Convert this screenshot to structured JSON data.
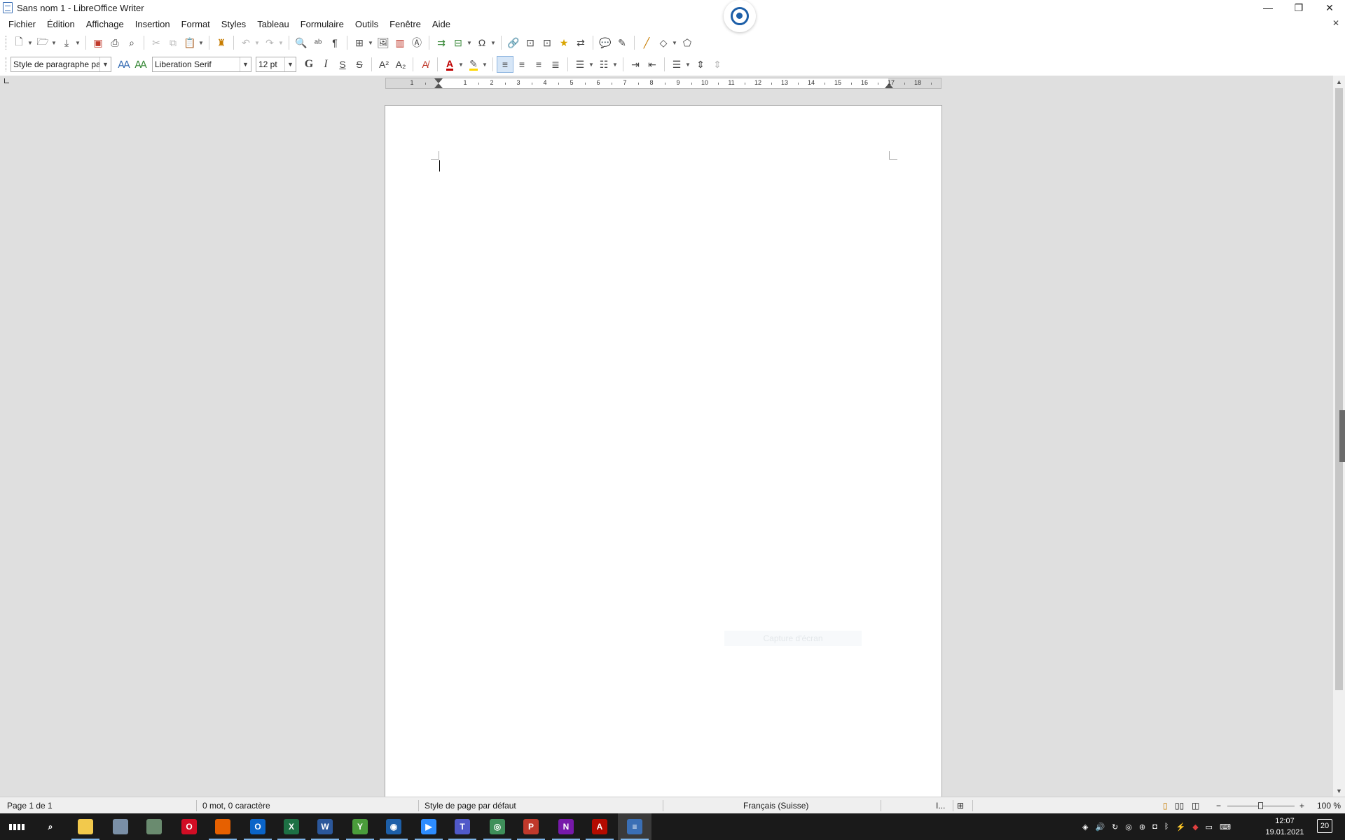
{
  "window": {
    "title": "Sans nom 1 - LibreOffice Writer",
    "controls": {
      "minimize": "—",
      "restore": "❐",
      "close": "✕"
    },
    "doc_close": "✕"
  },
  "menu": [
    "Fichier",
    "Édition",
    "Affichage",
    "Insertion",
    "Format",
    "Styles",
    "Tableau",
    "Formulaire",
    "Outils",
    "Fenêtre",
    "Aide"
  ],
  "formatting": {
    "paragraph_style": "Style de paragraphe par défaut",
    "font_name": "Liberation Serif",
    "font_size": "12 pt",
    "bold": "G",
    "italic": "I",
    "underline": "S",
    "strike": "S",
    "alignment": "left"
  },
  "ruler": {
    "ticks": [
      "1",
      "1",
      "2",
      "3",
      "4",
      "5",
      "6",
      "7",
      "8",
      "9",
      "10",
      "11",
      "12",
      "13",
      "14",
      "15",
      "16",
      "17",
      "18"
    ]
  },
  "page": {
    "ghost_text": "Capture d'écran"
  },
  "statusbar": {
    "page": "Page 1 de 1",
    "words": "0 mot, 0 caractère",
    "page_style": "Style de page par défaut",
    "language": "Français (Suisse)",
    "insert_mode": "I...",
    "zoom": "100 %",
    "zoom_minus": "−",
    "zoom_plus": "+"
  },
  "taskbar": {
    "apps": [
      {
        "name": "windows-start",
        "color": "#1a1a1a",
        "label": ""
      },
      {
        "name": "search",
        "color": "#1a1a1a",
        "label": "⌕"
      },
      {
        "name": "file-explorer",
        "color": "#f2c94c",
        "label": ""
      },
      {
        "name": "paint",
        "color": "#7a8fa6",
        "label": ""
      },
      {
        "name": "settings-tool",
        "color": "#6a8b6f",
        "label": ""
      },
      {
        "name": "opera",
        "color": "#d10d24",
        "label": "O"
      },
      {
        "name": "firefox",
        "color": "#e66000",
        "label": ""
      },
      {
        "name": "outlook",
        "color": "#0a64c8",
        "label": "O"
      },
      {
        "name": "excel",
        "color": "#1d7044",
        "label": "X"
      },
      {
        "name": "word",
        "color": "#2b579a",
        "label": "W"
      },
      {
        "name": "green-app",
        "color": "#4a9c3b",
        "label": "Y"
      },
      {
        "name": "remote-app",
        "color": "#1d5fa8",
        "label": "◉"
      },
      {
        "name": "zoom",
        "color": "#2d8cff",
        "label": "▶"
      },
      {
        "name": "teams",
        "color": "#5059c9",
        "label": "T"
      },
      {
        "name": "browser",
        "color": "#3f8f5a",
        "label": "◎"
      },
      {
        "name": "red-doc-app",
        "color": "#c0392b",
        "label": "P"
      },
      {
        "name": "onenote",
        "color": "#7719aa",
        "label": "N"
      },
      {
        "name": "acrobat",
        "color": "#b30b00",
        "label": "A"
      },
      {
        "name": "libreoffice-writer",
        "color": "#3a6fb5",
        "label": "≡"
      }
    ],
    "clock_time": "12:07",
    "clock_date": "19.01.2021",
    "notifications": "20"
  }
}
